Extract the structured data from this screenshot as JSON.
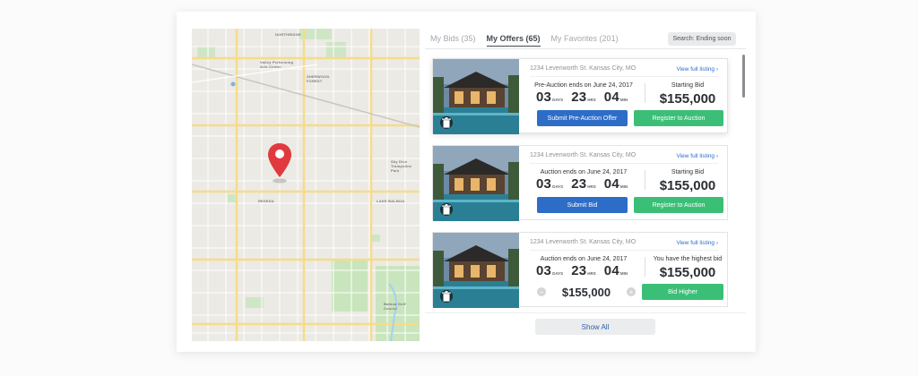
{
  "tabs": [
    {
      "label": "My Bids (35)"
    },
    {
      "label": "My Offers (65)"
    },
    {
      "label": "My Favorites (201)"
    }
  ],
  "search_label": "Search: Ending soon",
  "map": {
    "labels": [
      "NORTHRIDGE",
      "Valley Performing Arts Center",
      "SHERWOOD FOREST",
      "Sky Dive Trampoline Park",
      "RESEDA",
      "LAKE BALBOA",
      "Balboa Golf Course"
    ]
  },
  "listings": [
    {
      "address": "1234 Levenworth St. Kansas City, MO",
      "view_link": "View full listing ›",
      "auction_label": "Pre-Auction ends on June 24, 2017",
      "days": "03",
      "days_unit": "DAYS",
      "hrs": "23",
      "hrs_unit": "HRS",
      "min": "04",
      "min_unit": "MIN",
      "price_label": "Starting Bid",
      "price": "$155,000",
      "primary_button": "Submit Pre-Auction Offer",
      "secondary_button": "Register to Auction"
    },
    {
      "address": "1234 Levenworth St. Kansas City, MO",
      "view_link": "View full listing ›",
      "auction_label": "Auction ends on June 24, 2017",
      "days": "03",
      "days_unit": "DAYS",
      "hrs": "23",
      "hrs_unit": "HRS",
      "min": "04",
      "min_unit": "MIN",
      "price_label": "Starting Bid",
      "price": "$155,000",
      "primary_button": "Submit Bid",
      "secondary_button": "Register to Auction"
    },
    {
      "address": "1234 Levenworth St. Kansas City, MO",
      "view_link": "View full listing ›",
      "auction_label": "Auction ends on June 24, 2017",
      "days": "03",
      "days_unit": "DAYS",
      "hrs": "23",
      "hrs_unit": "HRS",
      "min": "04",
      "min_unit": "MIN",
      "price_label": "You have the highest bid",
      "price": "$155,000",
      "bid_value": "$155,000",
      "bid_button": "Bid Higher"
    }
  ],
  "show_all": "Show All",
  "colors": {
    "primary_blue": "#2e6dc7",
    "success_green": "#3bbf77",
    "pin_red": "#e0393e"
  }
}
